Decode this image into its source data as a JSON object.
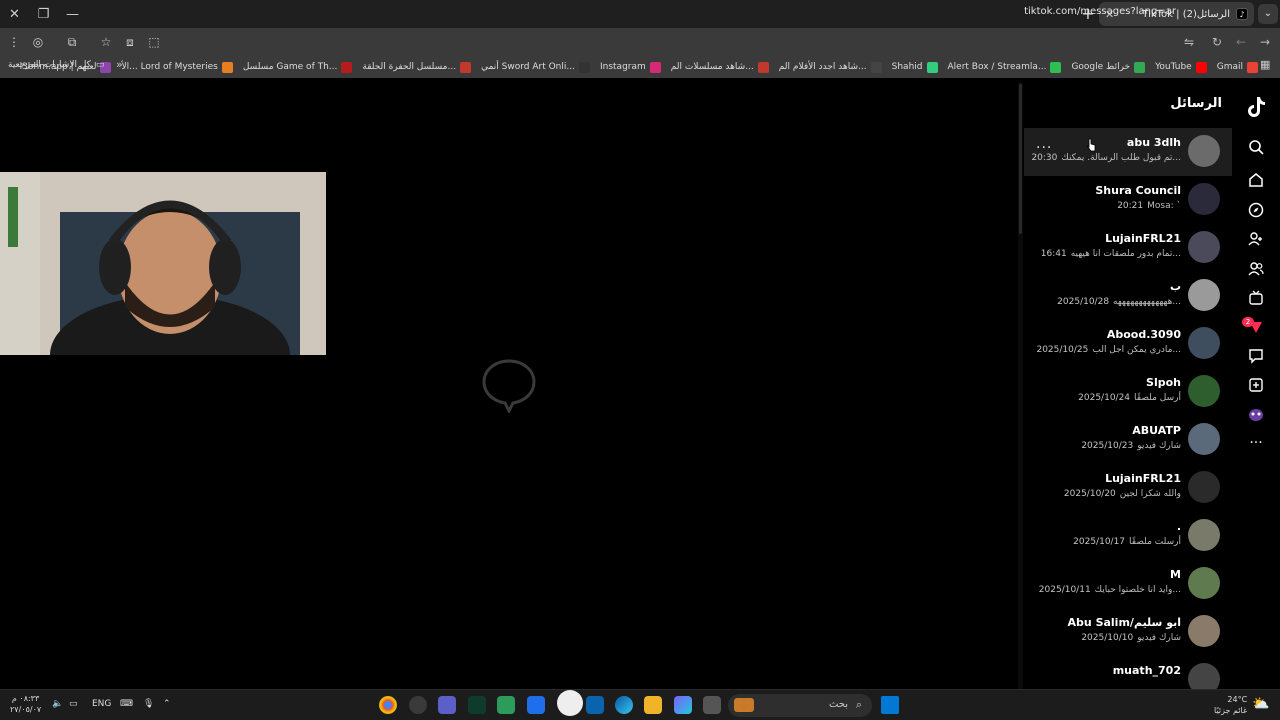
{
  "browser": {
    "tab_title": "TikTok | الرسائل(2)",
    "url": "tiktok.com/messages?lang=ar",
    "bookmarks": [
      {
        "label": "Gmail",
        "color": "#ea4335"
      },
      {
        "label": "YouTube",
        "color": "#ff0000"
      },
      {
        "label": "Google خرائط",
        "color": "#34a853"
      },
      {
        "label": "Alert Box / Streamla...",
        "color": "#2dbf4f"
      },
      {
        "label": "Shahid",
        "color": "#32cd7d"
      },
      {
        "label": "شاهد اجدد الأفلام الم...",
        "color": "#444444"
      },
      {
        "label": "شاهد مسلسلات الم...",
        "color": "#c0392b"
      },
      {
        "label": "Instagram",
        "color": "#d62976"
      },
      {
        "label": "أنمي Sword Art Onli...",
        "color": "#333333"
      },
      {
        "label": "مسلسل الحفرة الحلقة...",
        "color": "#c0392b"
      },
      {
        "label": "مسلسل Game of Th...",
        "color": "#b71c1c"
      },
      {
        "label": "الأ... Lord of Mysteries",
        "color": "#e67e22"
      },
      {
        "label": "l3bhm.app | لعبهم",
        "color": "#8e44ad"
      }
    ],
    "all_bookmarks_label": "كل الإشارات المرجعية"
  },
  "messages": {
    "title": "الرسائل",
    "conversations": [
      {
        "name": "abu 3dlh",
        "preview": "تم قبول طلب الرسالة. يمكنك...",
        "time": "20:30",
        "avatar_color": "#6b6b6b",
        "selected": true
      },
      {
        "name": "Shura Council",
        "preview": "Mosa: `",
        "time": "20:21",
        "avatar_color": "#2a2a3a",
        "selected": false
      },
      {
        "name": "LujainFRL21",
        "preview": "تمام بدور ملصقات انا هيهيه...",
        "time": "16:41",
        "avatar_color": "#4a4a5a",
        "selected": false
      },
      {
        "name": "ب",
        "preview": "هههههههههههههه...",
        "time": "2025/10/28",
        "avatar_color": "#9a9a9a",
        "selected": false
      },
      {
        "name": "Abood.3090",
        "preview": "مادري يمكن اجل الب...",
        "time": "2025/10/25",
        "avatar_color": "#3e4e5e",
        "selected": false
      },
      {
        "name": "Slpoh",
        "preview": "أرسل ملصقًا",
        "time": "2025/10/24",
        "avatar_color": "#2e5e2e",
        "selected": false
      },
      {
        "name": "ABUATP",
        "preview": "شارك فيديو",
        "time": "2025/10/23",
        "avatar_color": "#5a6a7a",
        "selected": false
      },
      {
        "name": "LujainFRL21",
        "preview": "والله شكرا لجين",
        "time": "2025/10/20",
        "avatar_color": "#2a2a2a",
        "selected": false
      },
      {
        "name": ".",
        "preview": "أرسلت ملصقًا",
        "time": "2025/10/17",
        "avatar_color": "#7a7a6a",
        "selected": false
      },
      {
        "name": "M",
        "preview": "وايد انا خلصتوا حبايك...",
        "time": "2025/10/11",
        "avatar_color": "#5e7a4e",
        "selected": false
      },
      {
        "name": "Abu Salim/ابو سليم",
        "preview": "شارك فيديو",
        "time": "2025/10/10",
        "avatar_color": "#8a7a6a",
        "selected": false
      },
      {
        "name": "muath_702",
        "preview": "",
        "time": "",
        "avatar_color": "#444444",
        "selected": false
      }
    ]
  },
  "sidebar": {
    "icons": [
      "tiktok-logo-icon",
      "search-icon",
      "home-icon",
      "explore-icon",
      "following-icon",
      "friends-icon",
      "live-icon",
      "activity-icon",
      "messages-icon",
      "upload-icon",
      "profile-icon",
      "more-icon"
    ],
    "activity_badge": "2"
  },
  "taskbar": {
    "time": "٠٨:٣٣ م",
    "date": "٢٧/٠٥/٠٧",
    "lang": "ENG",
    "search_placeholder": "بحث",
    "weather_temp": "24°C",
    "weather_desc": "غائم جزئيًا"
  }
}
